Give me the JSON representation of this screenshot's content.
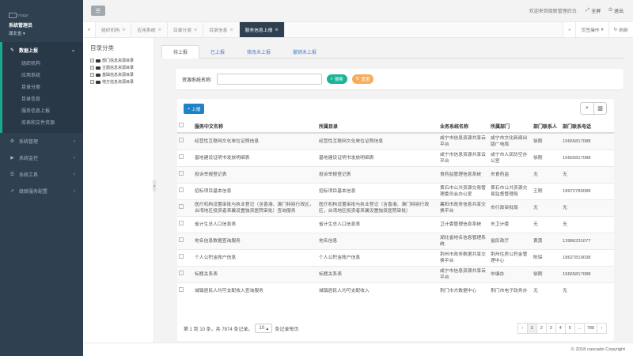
{
  "sidebar": {
    "avatar_alt": "Image",
    "user_name": "系统管理员",
    "user_dept": "湖北省",
    "menu": [
      {
        "label": "数据上报",
        "icon": "edit-icon",
        "glyph": "✎",
        "active": true,
        "items": [
          "组织机构",
          "应用系统",
          "目录分类",
          "目录信息",
          "服务信息上报",
          "库表和文件资源"
        ]
      },
      {
        "label": "系统管理",
        "icon": "gear-icon",
        "glyph": "⚙",
        "active": false,
        "items": []
      },
      {
        "label": "系统监控",
        "icon": "video-icon",
        "glyph": "▶",
        "active": false,
        "items": []
      },
      {
        "label": "系统工具",
        "icon": "list-icon",
        "glyph": "☰",
        "active": false,
        "items": []
      },
      {
        "label": "级联服务配置",
        "icon": "external-link-icon",
        "glyph": "⇗",
        "active": false,
        "items": []
      }
    ]
  },
  "topbar": {
    "welcome": "欢迎来到级联管理后台.",
    "fullscreen": "全屏",
    "logout": "退出"
  },
  "tabs": {
    "items": [
      {
        "label": "组织机构",
        "active": false
      },
      {
        "label": "应用系统",
        "active": false
      },
      {
        "label": "目录分类",
        "active": false
      },
      {
        "label": "目录信息",
        "active": false
      },
      {
        "label": "服务信息上报",
        "active": true
      }
    ],
    "page_ops": "页签操作",
    "refresh": "刷新"
  },
  "tree": {
    "title": "目录分类",
    "items": [
      "部门信息资源目录",
      "主题信息资源目录",
      "基础信息资源目录",
      "地方信息资源目录"
    ]
  },
  "subtabs": [
    "待上报",
    "已上报",
    "修改未上报",
    "撤销未上报"
  ],
  "search": {
    "label": "资源系统名称:",
    "value": "",
    "search_btn": "搜索",
    "reset_btn": "重置"
  },
  "table": {
    "add_btn": "上报",
    "headers": [
      "服务中文名称",
      "所属目录",
      "业务系统名称",
      "所属部门",
      "部门联系人",
      "部门联系电话"
    ],
    "rows": [
      [
        "经营性互联网文化单位证照信息",
        "经营性互联网文化单位证照信息",
        "咸宁市信息资源共享云平台",
        "咸宁市文化新闻出版广电局",
        "徐刚",
        "15665817088"
      ],
      [
        "基地建设证明书发放明细表",
        "基地建设证明书发放明细表",
        "咸宁市信息资源共享云平台",
        "咸宁市人民防空办公室",
        "徐刚",
        "15665817088"
      ],
      [
        "投诉举报登记表",
        "投诉举报登记表",
        "食药监管理信息系统",
        "市食药监",
        "无",
        "无"
      ],
      [
        "招标项目基本信息",
        "招标项目基本信息",
        "黄石市公共资源交易管理委员会办公室",
        "黄石市公共资源交易监督管理局",
        "王刚",
        "18972780088"
      ],
      [
        "医疗机构设置审批与执业登记（含香港、澳门特别行政区，台湾地区投资者来襄设置独资医院审批）查询服务",
        "医疗机构设置审批与执业登记（含香港、澳门特别行政区，台湾地区投资者来襄设置独资医院审批）",
        "襄阳市政务信息共享交换平台",
        "市行政审批局",
        "无",
        "无"
      ],
      [
        "省计生总人口信息表",
        "省计生总人口信息表",
        "卫计委管理信息系统",
        "市卫计委",
        "无",
        "无"
      ],
      [
        "地名信息数据查询服务",
        "地名信息",
        "湖北省地名信息管理系统",
        "省民政厅",
        "黄勇",
        "13986231077"
      ],
      [
        "个人公积金账户信息",
        "个人公积金账户信息",
        "荆州市政务数据共享交换平台",
        "荆州住房公积金管理中心",
        "陈琛",
        "18627819038"
      ],
      [
        "标题关系表",
        "标题关系表",
        "咸宁市信息资源共享云平台",
        "市编办",
        "徐刚",
        "15665817088"
      ],
      [
        "城镇居民人均可支配收入查询服务",
        "城镇居民人均可支配收入",
        "荆门市大数据中心",
        "荆门市电子政务办",
        "无",
        "无"
      ]
    ]
  },
  "pager": {
    "info_prefix": "第 1 到 10 条，共 7874 条记录。",
    "page_size": "10",
    "info_suffix": "条记录每页",
    "prev": "‹",
    "next": "›",
    "pages": [
      "1",
      "2",
      "3",
      "4",
      "5",
      "...",
      "788"
    ]
  },
  "footer": {
    "copyright": "© 2018 cascade Copyright"
  }
}
